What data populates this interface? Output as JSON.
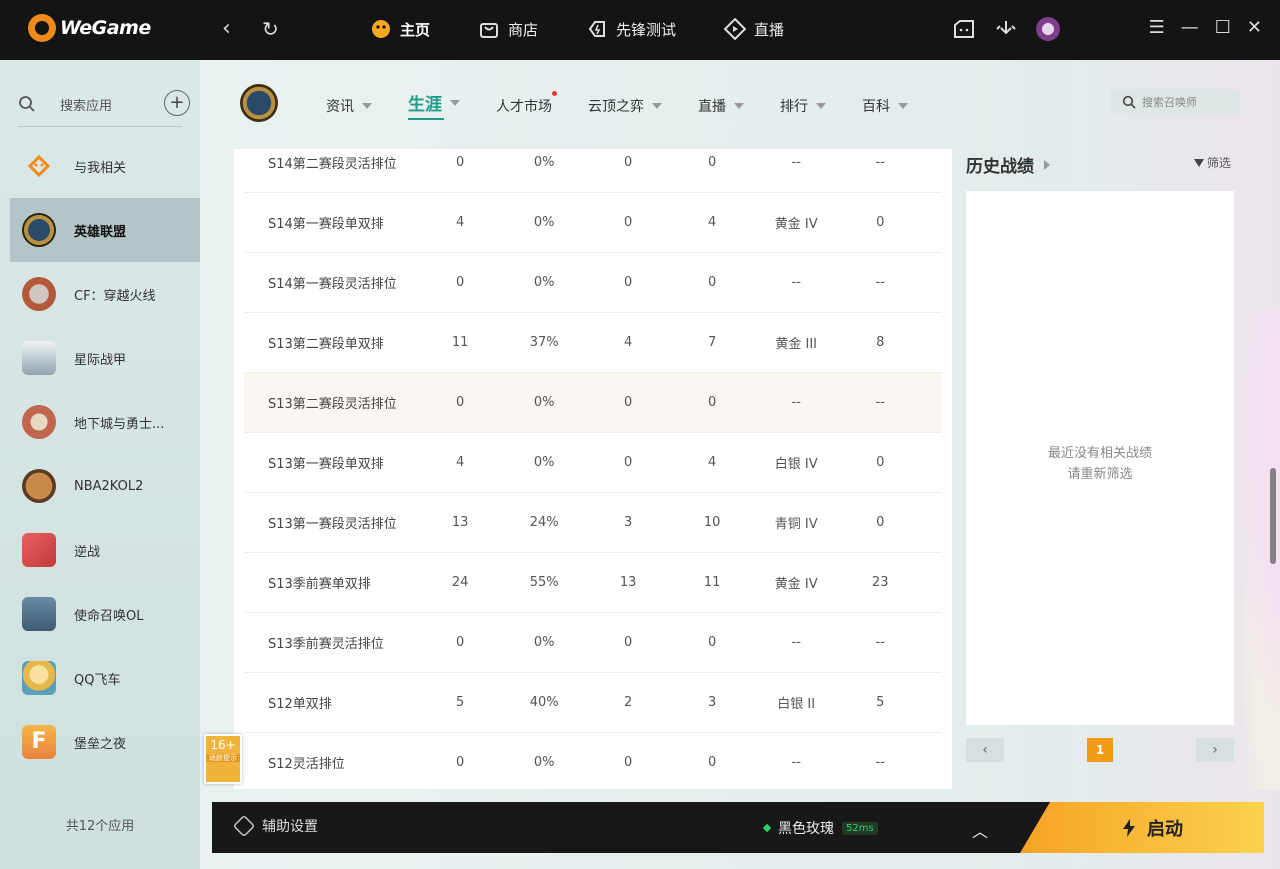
{
  "app": {
    "logo_text": "WeGame",
    "back_icon": "back-arrow-icon",
    "refresh_icon": "refresh-icon",
    "nav": [
      {
        "label": "主页",
        "icon": "home-icon",
        "active": true
      },
      {
        "label": "商店",
        "icon": "shop-bag-icon",
        "active": false
      },
      {
        "label": "先锋测试",
        "icon": "pioneer-test-icon",
        "active": false
      },
      {
        "label": "直播",
        "icon": "live-play-icon",
        "active": false
      }
    ],
    "window_controls": [
      "menu-icon",
      "minimize-icon",
      "maximize-icon",
      "close-icon"
    ]
  },
  "sidebar": {
    "search_label": "搜索应用",
    "add_icon": "plus-icon",
    "items": [
      {
        "label": "与我相关",
        "icon": "related-icon",
        "color": "#f08a1a"
      },
      {
        "label": "英雄联盟",
        "icon": "lol-icon",
        "color": "#2b4a6a",
        "active": true
      },
      {
        "label": "CF：穿越火线",
        "icon": "cf-icon",
        "color": "#b45a3a"
      },
      {
        "label": "星际战甲",
        "icon": "warframe-icon",
        "color": "#8fa4b0"
      },
      {
        "label": "地下城与勇士...",
        "icon": "dnf-icon",
        "color": "#c0664e"
      },
      {
        "label": "NBA2KOL2",
        "icon": "nba-icon",
        "color": "#7a4a30"
      },
      {
        "label": "逆战",
        "icon": "nizhan-icon",
        "color": "#c43a3a"
      },
      {
        "label": "使命召唤OL",
        "icon": "codol-icon",
        "color": "#3f5a74"
      },
      {
        "label": "QQ飞车",
        "icon": "qqspeed-icon",
        "color": "#e6b84a"
      },
      {
        "label": "堡垒之夜",
        "icon": "fortnite-icon",
        "color": "#f29b2b"
      }
    ],
    "count_label": "共12个应用",
    "age_badge": {
      "label": "16+",
      "sub": "适龄提示"
    }
  },
  "subnav": {
    "items": [
      {
        "label": "资讯",
        "caret": true
      },
      {
        "label": "生涯",
        "caret": true,
        "active": true
      },
      {
        "label": "人才市场",
        "caret": false,
        "dot": true
      },
      {
        "label": "云顶之弈",
        "caret": true
      },
      {
        "label": "直播",
        "caret": true
      },
      {
        "label": "排行",
        "caret": true
      },
      {
        "label": "百科",
        "caret": true
      }
    ],
    "search_placeholder": "搜索召唤师"
  },
  "records": [
    {
      "name": "S14第二赛段灵活排位",
      "a": "0",
      "b": "0%",
      "c": "0",
      "d": "0",
      "rank": "--",
      "e": "--"
    },
    {
      "name": "S14第一赛段单双排",
      "a": "4",
      "b": "0%",
      "c": "0",
      "d": "4",
      "rank": "黄金 IV",
      "e": "0"
    },
    {
      "name": "S14第一赛段灵活排位",
      "a": "0",
      "b": "0%",
      "c": "0",
      "d": "0",
      "rank": "--",
      "e": "--"
    },
    {
      "name": "S13第二赛段单双排",
      "a": "11",
      "b": "37%",
      "c": "4",
      "d": "7",
      "rank": "黄金 III",
      "e": "8"
    },
    {
      "name": "S13第二赛段灵活排位",
      "a": "0",
      "b": "0%",
      "c": "0",
      "d": "0",
      "rank": "--",
      "e": "--"
    },
    {
      "name": "S13第一赛段单双排",
      "a": "4",
      "b": "0%",
      "c": "0",
      "d": "4",
      "rank": "白银 IV",
      "e": "0"
    },
    {
      "name": "S13第一赛段灵活排位",
      "a": "13",
      "b": "24%",
      "c": "3",
      "d": "10",
      "rank": "青铜 IV",
      "e": "0"
    },
    {
      "name": "S13季前赛单双排",
      "a": "24",
      "b": "55%",
      "c": "13",
      "d": "11",
      "rank": "黄金 IV",
      "e": "23"
    },
    {
      "name": "S13季前赛灵活排位",
      "a": "0",
      "b": "0%",
      "c": "0",
      "d": "0",
      "rank": "--",
      "e": "--"
    },
    {
      "name": "S12单双排",
      "a": "5",
      "b": "40%",
      "c": "2",
      "d": "3",
      "rank": "白银 II",
      "e": "5"
    },
    {
      "name": "S12灵活排位",
      "a": "0",
      "b": "0%",
      "c": "0",
      "d": "0",
      "rank": "--",
      "e": "--"
    }
  ],
  "history": {
    "title": "历史战绩",
    "filter_label": "筛选",
    "empty_line1": "最近没有相关战绩",
    "empty_line2": "请重新筛选",
    "page": "1",
    "prev": "‹",
    "next": "›"
  },
  "bottom": {
    "assist_label": "辅助设置",
    "server_name": "黑色玫瑰",
    "ping": "52ms",
    "launch_label": "启动",
    "launch_icon": "lightning-icon"
  }
}
